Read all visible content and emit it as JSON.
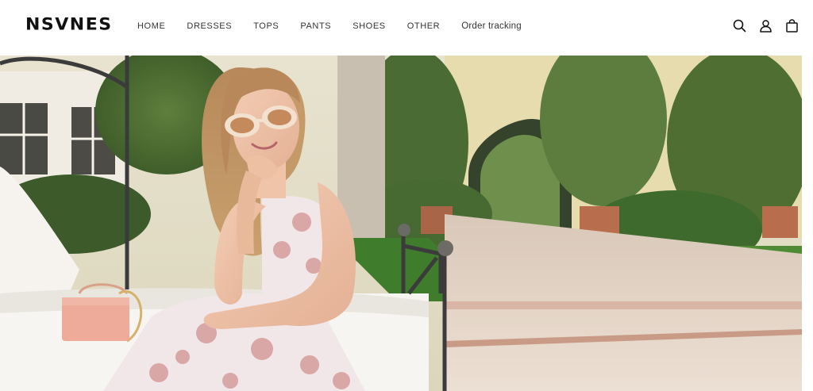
{
  "brand": {
    "logo": "NSVNES"
  },
  "nav": {
    "items": [
      {
        "label": "HOME"
      },
      {
        "label": "DRESSES"
      },
      {
        "label": "TOPS"
      },
      {
        "label": "PANTS"
      },
      {
        "label": "SHOES"
      },
      {
        "label": "OTHER"
      },
      {
        "label": "Order tracking"
      }
    ]
  },
  "header_icons": [
    "search-icon",
    "account-icon",
    "cart-icon"
  ],
  "hero": {
    "image": "woman-in-floral-dress-with-sunglasses-and-pink-handbag"
  },
  "colors": {
    "text": "#333333",
    "logo": "#111111",
    "background": "#ffffff"
  }
}
